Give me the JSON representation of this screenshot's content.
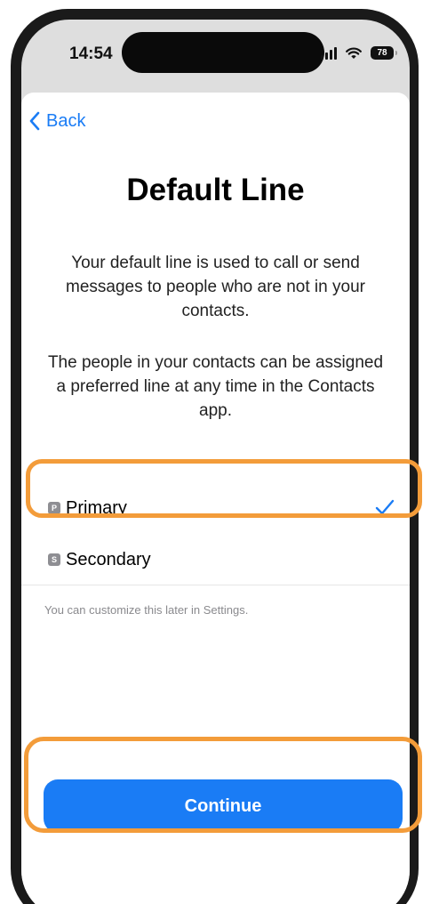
{
  "status_bar": {
    "time": "14:54",
    "battery": "78"
  },
  "nav": {
    "back_label": "Back"
  },
  "content": {
    "title": "Default Line",
    "description_1": "Your default line is used to call or send messages to people who are not in your contacts.",
    "description_2": "The people in your contacts can be assigned a preferred line at any time in the Contacts app."
  },
  "options": [
    {
      "badge": "P",
      "label": "Primary",
      "selected": true
    },
    {
      "badge": "S",
      "label": "Secondary",
      "selected": false
    }
  ],
  "footnote": "You can customize this later in Settings.",
  "continue_label": "Continue",
  "colors": {
    "accent": "#1a7cf5",
    "highlight": "#f39c3a"
  }
}
